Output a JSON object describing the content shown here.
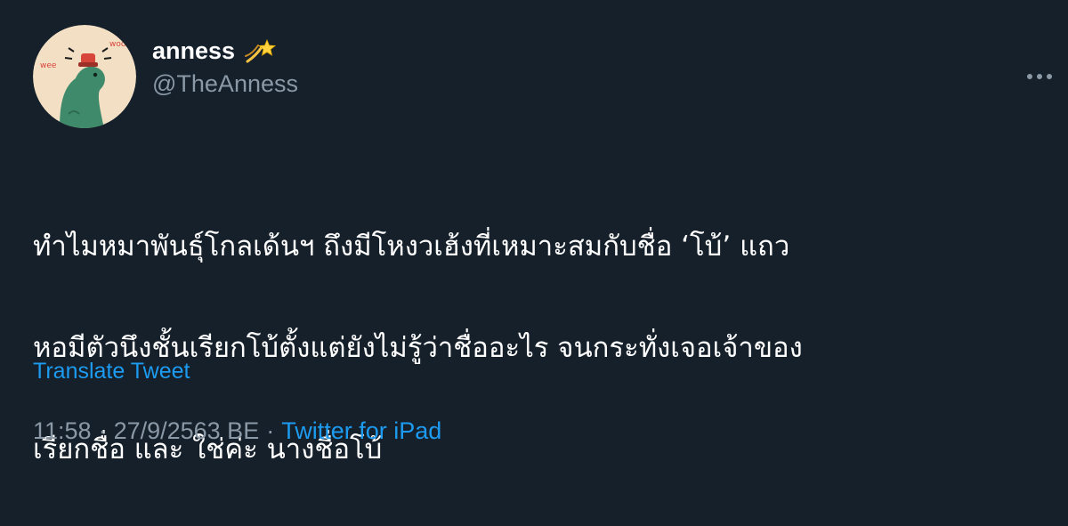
{
  "author": {
    "display_name": "anness",
    "handle": "@TheAnness",
    "name_emoji": "dizzy-icon",
    "avatar_texts": [
      "woo",
      "wee"
    ]
  },
  "tweet": {
    "text_lines": [
      "ทำไมหมาพันธุ์โกลเด้นฯ ถึงมีโหงวเฮ้งที่เหมาะสมกับชื่อ ‘โบ้’ แถว",
      "หอมีตัวนึงชั้นเรียกโบ้ตั้งแต่ยังไม่รู้ว่าชื่ออะไร จนกระทั่งเจอเจ้าของ",
      "เรียกชื่อ และ ใช่ค่ะ นางชื่อโบ้"
    ],
    "translate_label": "Translate Tweet",
    "time": "11:58",
    "date": "27/9/2563 BE",
    "separator": "·",
    "source": "Twitter for iPad"
  },
  "icons": {
    "more": "more-horizontal-icon"
  },
  "colors": {
    "background": "#15202b",
    "text": "#ffffff",
    "secondary": "#8b98a5",
    "accent": "#1d9bf0",
    "avatar_bg": "#f2dfc4",
    "avatar_figure": "#3e8a6a"
  }
}
